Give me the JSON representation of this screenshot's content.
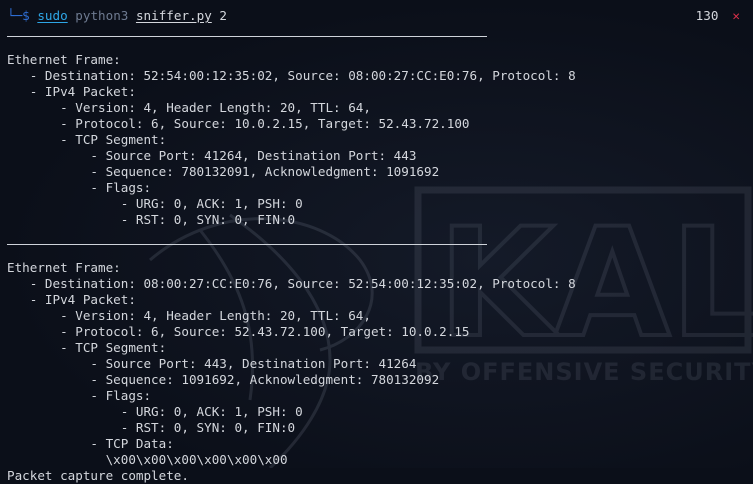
{
  "terminal": {
    "prompt_glyph": "└─$",
    "command": {
      "sudo": "sudo",
      "interpreter": "python3",
      "script": "sniffer.py",
      "argument": "2"
    },
    "exit_code": "130",
    "exit_icon": "✕"
  },
  "frames": [
    {
      "title": "Ethernet Frame:",
      "ethernet": "   - Destination: 52:54:00:12:35:02, Source: 08:00:27:CC:E0:76, Protocol: 8",
      "ipv4_title": "   - IPv4 Packet:",
      "ipv4_line1": "       - Version: 4, Header Length: 20, TTL: 64,",
      "ipv4_line2": "       - Protocol: 6, Source: 10.0.2.15, Target: 52.43.72.100",
      "tcp_title": "       - TCP Segment:",
      "ports": "           - Source Port: 41264, Destination Port: 443",
      "sequence": "           - Sequence: 780132091, Acknowledgment: 1091692",
      "flags_title": "           - Flags:",
      "flags_line1": "               - URG: 0, ACK: 1, PSH: 0",
      "flags_line2": "               - RST: 0, SYN: 0, FIN:0"
    },
    {
      "title": "Ethernet Frame:",
      "ethernet": "   - Destination: 08:00:27:CC:E0:76, Source: 52:54:00:12:35:02, Protocol: 8",
      "ipv4_title": "   - IPv4 Packet:",
      "ipv4_line1": "       - Version: 4, Header Length: 20, TTL: 64,",
      "ipv4_line2": "       - Protocol: 6, Source: 52.43.72.100, Target: 10.0.2.15",
      "tcp_title": "       - TCP Segment:",
      "ports": "           - Source Port: 443, Destination Port: 41264",
      "sequence": "           - Sequence: 1091692, Acknowledgment: 780132092",
      "flags_title": "           - Flags:",
      "flags_line1": "               - URG: 0, ACK: 1, PSH: 0",
      "flags_line2": "               - RST: 0, SYN: 0, FIN:0",
      "data_title": "           - TCP Data:",
      "data_value": "             \\x00\\x00\\x00\\x00\\x00\\x00"
    }
  ],
  "completion_message": "Packet capture complete.",
  "watermark": {
    "brand": "KALI",
    "tagline": "BY OFFENSIVE SECURITY"
  }
}
